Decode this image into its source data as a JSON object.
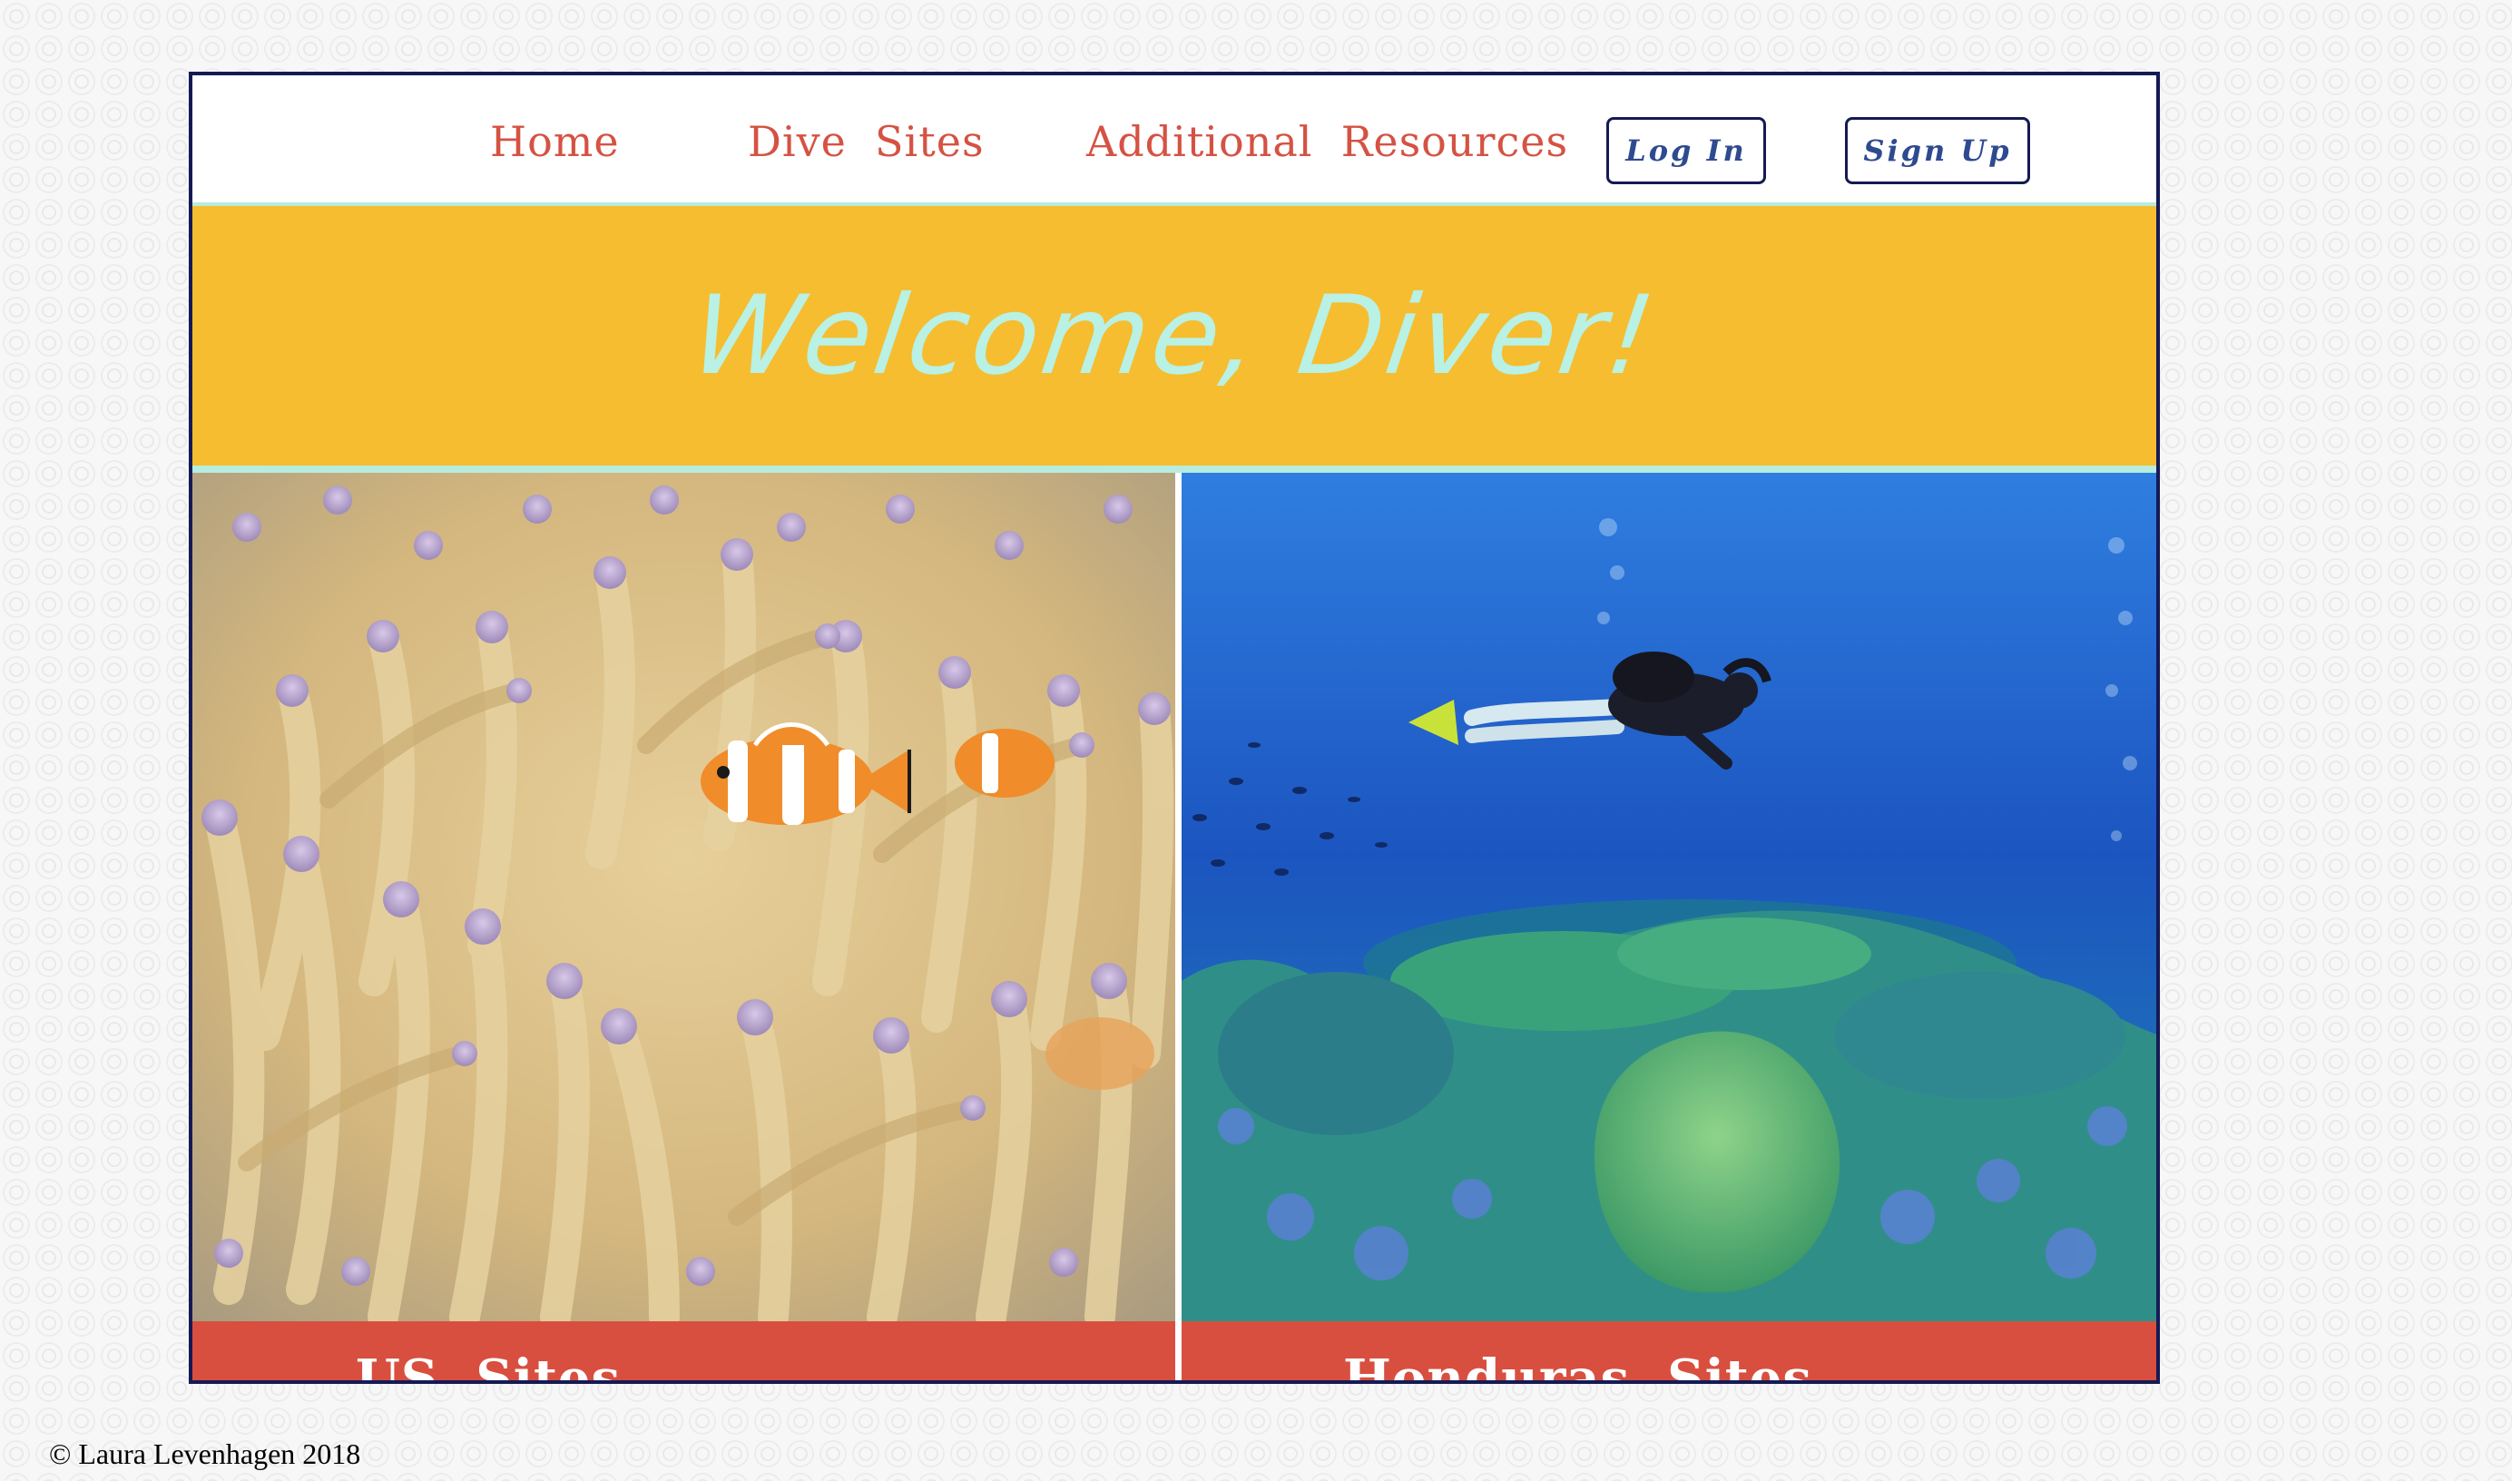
{
  "nav": {
    "links": [
      {
        "label": "Home"
      },
      {
        "label": "Dive  Sites"
      },
      {
        "label": "Additional  Resources"
      }
    ],
    "login_label": "Log In",
    "signup_label": "Sign Up"
  },
  "banner": {
    "title": "Welcome, Diver!"
  },
  "panels": [
    {
      "caption": "US  Sites",
      "image": "clownfish-anemone-photo"
    },
    {
      "caption": "Honduras  Sites",
      "image": "scuba-diver-reef-photo"
    }
  ],
  "footer": {
    "text": "© Laura Levenhagen 2018"
  },
  "colors": {
    "frame_border": "#151a54",
    "nav_link": "#d55243",
    "button_text": "#2e4a90",
    "banner_bg": "#f6bd30",
    "banner_text": "#b9f1e4",
    "caption_bg": "#d84f3f",
    "caption_text": "#ffffff"
  }
}
